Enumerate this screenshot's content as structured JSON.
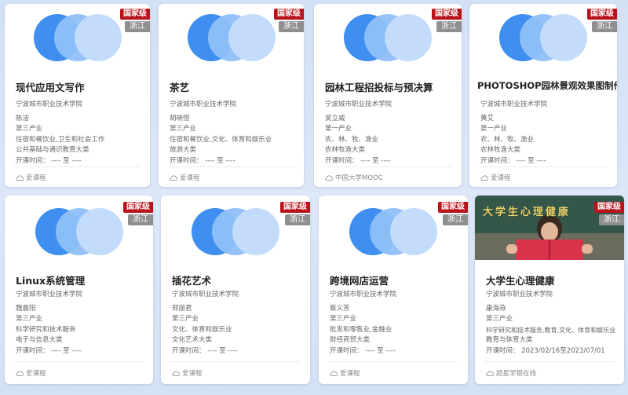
{
  "courses": [
    {
      "title": "现代应用文写作",
      "level": "国家级",
      "region": "浙江",
      "school": "宁波城市职业技术学院",
      "teacher": "陈洁",
      "industry": "第三产业",
      "field": "住宿和餐饮业,卫生和社会工作",
      "category": "公共基础与通识教育大类",
      "time": "开课时间： ---- 至 ----",
      "platform": "爱课程"
    },
    {
      "title": "茶艺",
      "level": "国家级",
      "region": "浙江",
      "school": "宁波城市职业技术学院",
      "teacher": "胡晓恒",
      "industry": "第三产业",
      "field": "住宿和餐饮业,文化、体育和娱乐业",
      "category": "旅游大类",
      "time": "开课时间： ---- 至 ----",
      "platform": "爱课程"
    },
    {
      "title": "园林工程招投标与预决算",
      "level": "国家级",
      "region": "浙江",
      "school": "宁波城市职业技术学院",
      "teacher": "吴立威",
      "industry": "第一产业",
      "field": "农、林、牧、渔业",
      "category": "农林牧渔大类",
      "time": "开课时间： ---- 至 ----",
      "platform": "中国大学MOOC"
    },
    {
      "title": "PHOTOSHOP园林景观效果图制作",
      "level": "国家级",
      "region": "浙江",
      "school": "宁波城市职业技术学院",
      "teacher": "黄艾",
      "industry": "第一产业",
      "field": "农、林、牧、渔业",
      "category": "农林牧渔大类",
      "time": "开课时间： ---- 至 ----",
      "platform": "爱课程"
    },
    {
      "title": "Linux系统管理",
      "level": "国家级",
      "region": "浙江",
      "school": "宁波城市职业技术学院",
      "teacher": "魏晨阳",
      "industry": "第三产业",
      "field": "科学研究和技术服务",
      "category": "电子与信息大类",
      "time": "开课时间： ---- 至 ----",
      "platform": "爱课程"
    },
    {
      "title": "插花艺术",
      "level": "国家级",
      "region": "浙江",
      "school": "宁波城市职业技术学院",
      "teacher": "郑丽君",
      "industry": "第三产业",
      "field": "文化、体育和娱乐业",
      "category": "文化艺术大类",
      "time": "开课时间： ---- 至 ----",
      "platform": "爱课程"
    },
    {
      "title": "跨境网店运营",
      "level": "国家级",
      "region": "浙江",
      "school": "宁波城市职业技术学院",
      "teacher": "蔡义芳",
      "industry": "第三产业",
      "field": "批发和零售业,金融业",
      "category": "财经商贸大类",
      "time": "开课时间： ---- 至 ----",
      "platform": "爱课程"
    },
    {
      "title": "大学生心理健康",
      "level": "国家级",
      "region": "浙江",
      "school": "宁波城市职业技术学院",
      "teacher": "康海燕",
      "industry": "第三产业",
      "field": "科学研究和技术服务,教育,文化、体育和娱乐业",
      "category": "教育与体育大类",
      "time": "开课时间： 2023/02/16至2023/07/01",
      "platform": "超星学银在线",
      "photo_caption": "大学生心理健康"
    }
  ]
}
